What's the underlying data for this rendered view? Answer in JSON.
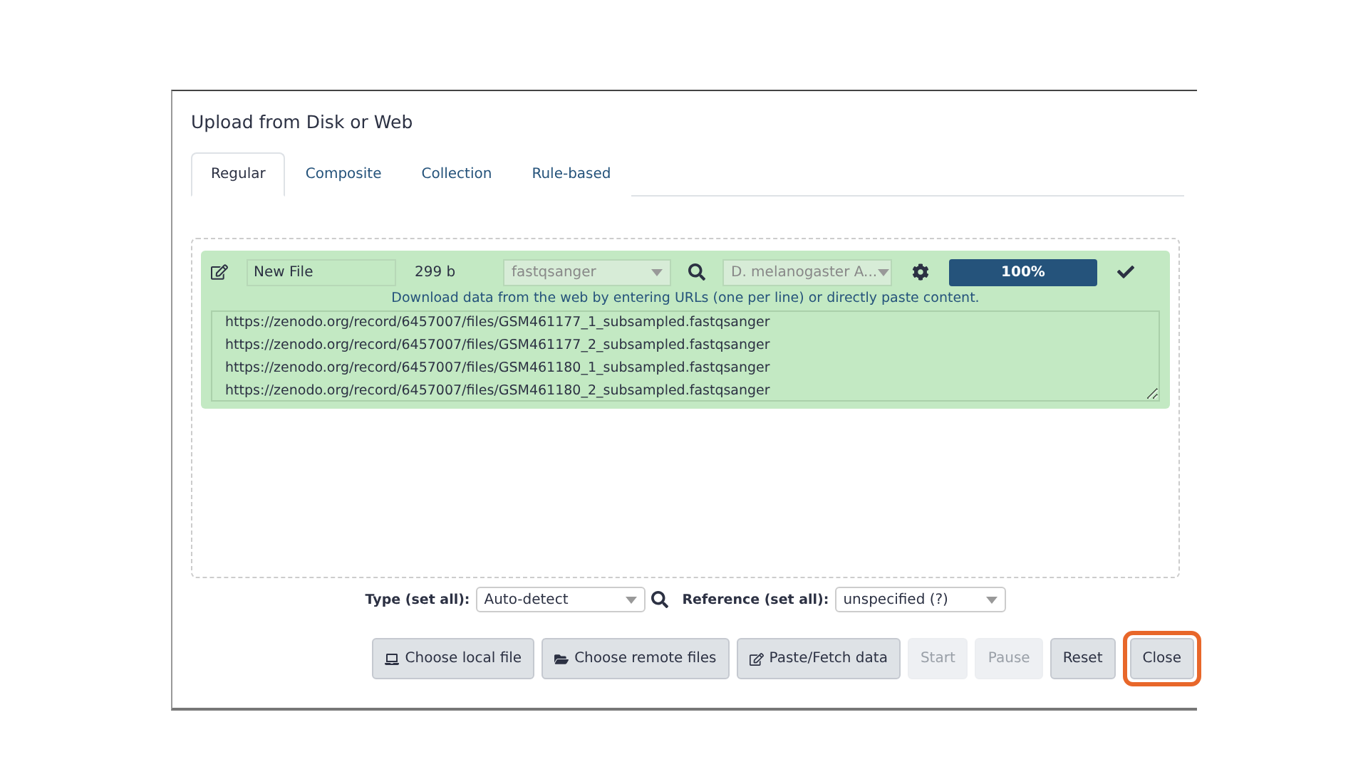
{
  "window": {
    "title": "Upload from Disk or Web"
  },
  "tabs": [
    {
      "label": "Regular",
      "selected": true
    },
    {
      "label": "Composite",
      "selected": false
    },
    {
      "label": "Collection",
      "selected": false
    },
    {
      "label": "Rule-based",
      "selected": false
    }
  ],
  "upload_item": {
    "name": "New File",
    "size": "299 b",
    "type": "fastqsanger",
    "genome": "D. melanogaster A...",
    "progress": {
      "level": 1,
      "label": "100%"
    },
    "hint": "Download data from the web by entering URLs (one per line) or directly paste content.",
    "content": [
      "https://zenodo.org/record/6457007/files/GSM461177_1_subsampled.fastqsanger",
      "https://zenodo.org/record/6457007/files/GSM461177_2_subsampled.fastqsanger",
      "https://zenodo.org/record/6457007/files/GSM461180_1_subsampled.fastqsanger",
      "https://zenodo.org/record/6457007/files/GSM461180_2_subsampled.fastqsanger"
    ]
  },
  "set_all": {
    "type_label": "Type (set all):",
    "type_value": "Auto-detect",
    "reference_label": "Reference (set all):",
    "reference_value": "unspecified (?)"
  },
  "buttons": [
    {
      "label": "Choose local file",
      "kind": "local",
      "disabled": false,
      "highlighted": false
    },
    {
      "label": "Choose remote files",
      "kind": "remote",
      "disabled": false,
      "highlighted": false
    },
    {
      "label": "Paste/Fetch data",
      "kind": "paste",
      "disabled": false,
      "highlighted": false
    },
    {
      "label": "Start",
      "kind": "plain",
      "disabled": true,
      "highlighted": false
    },
    {
      "label": "Pause",
      "kind": "plain",
      "disabled": true,
      "highlighted": false
    },
    {
      "label": "Reset",
      "kind": "plain",
      "disabled": false,
      "highlighted": false
    },
    {
      "label": "Close",
      "kind": "plain",
      "disabled": false,
      "highlighted": true
    }
  ]
}
